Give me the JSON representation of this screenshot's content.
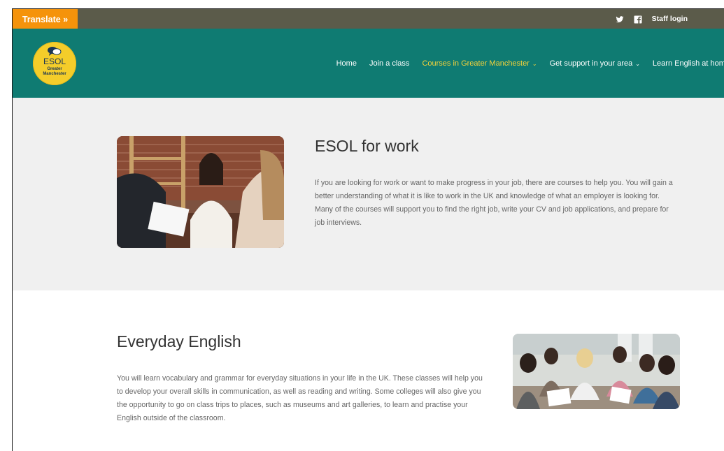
{
  "topbar": {
    "translate_label": "Translate »",
    "staff_login_label": "Staff login",
    "icons": [
      "twitter-icon",
      "facebook-icon"
    ]
  },
  "logo": {
    "line1": "ESOL",
    "line2": "Greater",
    "line3": "Manchester"
  },
  "nav": {
    "items": [
      {
        "label": "Home"
      },
      {
        "label": "Join a class"
      },
      {
        "label": "Courses in Greater Manchester",
        "active": true,
        "dropdown": true
      },
      {
        "label": "Get support in your area",
        "dropdown": true
      },
      {
        "label": "Learn English at home"
      }
    ]
  },
  "sections": {
    "work": {
      "title": "ESOL for work",
      "body": "If you are looking for work or want to make progress in your job, there are courses to help you. You will gain a better understanding of what it is like to work in the UK and knowledge of what an employer is looking for. Many of the courses will support you to find the right job, write your CV and job applications, and prepare for job interviews."
    },
    "everyday": {
      "title": "Everyday English",
      "body": "You will learn vocabulary and grammar for everyday situations in your life in the UK. These classes will help you to develop your overall skills in communication, as well as reading and writing. Some colleges will also give you the opportunity to go on class trips to places, such as museums and art galleries, to learn and practise your English outside of the classroom."
    }
  },
  "colors": {
    "topbar": "#5b5b4a",
    "translate": "#f5930b",
    "header": "#0f7b72",
    "active_nav": "#f5d23a",
    "logo": "#f4cd2a"
  }
}
